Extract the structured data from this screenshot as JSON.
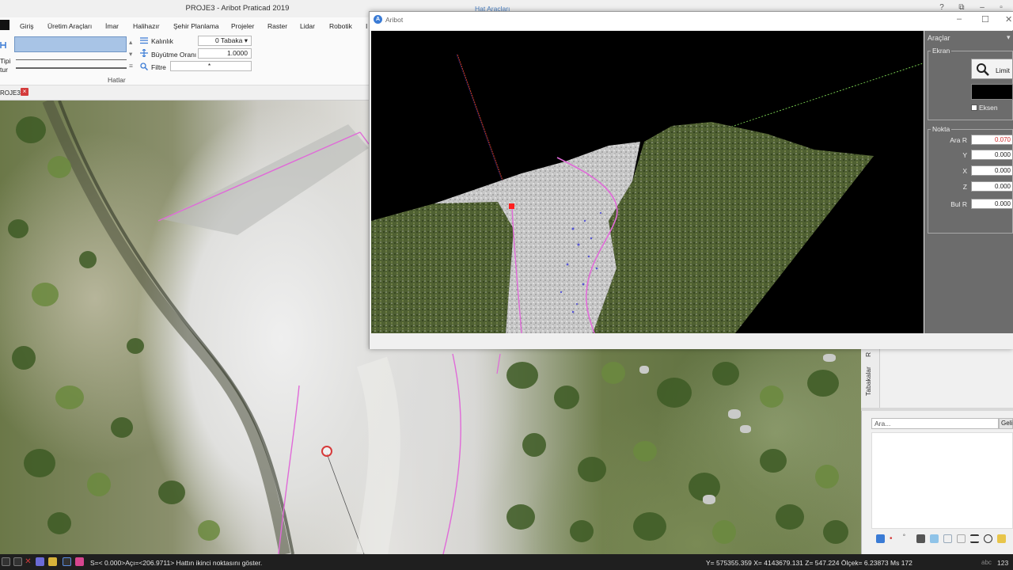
{
  "app": {
    "title": "PROJE3 - Aribot Praticad 2019",
    "context_tab": "Hat Araçları",
    "controls": {
      "help": "?",
      "restore": "⧉",
      "minimize": "–",
      "maximize": "▫"
    }
  },
  "menu": {
    "items": [
      "Giriş",
      "Üretim Araçları",
      "İmar",
      "Halihazır",
      "Şehir Planlama",
      "Projeler",
      "Raster",
      "Lidar",
      "Robotik",
      "I"
    ]
  },
  "ribbon": {
    "left_labels": [
      "Tipi",
      "tur"
    ],
    "kalinlik_label": "Kalınlık",
    "kalinlik_value": "0 Tabaka",
    "buyutme_label": "Büyütme Oranı",
    "buyutme_value": "1.0000",
    "filtre_label": "Filtre",
    "filtre_value": "*",
    "group_label": "Hatlar"
  },
  "document_tab": {
    "label": "ROJE3",
    "close": "×"
  },
  "viewer": {
    "title": "Aribot",
    "logo": "A",
    "controls": {
      "minimize": "–",
      "maximize": "☐",
      "close": "✕"
    },
    "tools": {
      "header": "Araçlar",
      "pin": "▾",
      "ekran_legend": "Ekran",
      "limit_label": "Limit",
      "eksen_label": "Eksen",
      "eksen_checked": false,
      "nokta_legend": "Nokta",
      "fields": [
        {
          "label": "Ara R",
          "value": "0.070",
          "highlight": true
        },
        {
          "label": "Y",
          "value": "0.000",
          "highlight": false
        },
        {
          "label": "X",
          "value": "0.000",
          "highlight": false
        },
        {
          "label": "Z",
          "value": "0.000",
          "highlight": false
        },
        {
          "label": "Bul R",
          "value": "0.000",
          "highlight": false
        }
      ]
    }
  },
  "dock": {
    "vertical_tabs": [
      "Tabakalar",
      "R"
    ],
    "search_placeholder": "Ara...",
    "search_button": "Gelişmiş"
  },
  "status": {
    "message": "S=< 0.000>Açı=<206.9711> Hattın ikinci noktasını göster.",
    "coords": "Y= 575355.359 X= 4143679.131 Z= 547.224  Ölçek= 6.23873 Ms 172",
    "right_text": "abc",
    "right_number": "123"
  },
  "colors": {
    "accent_blue": "#4a7fc1",
    "selection_pink": "#e06ad8",
    "marker_red": "#d63a3a",
    "tools_panel_bg": "#6c6c6c"
  }
}
